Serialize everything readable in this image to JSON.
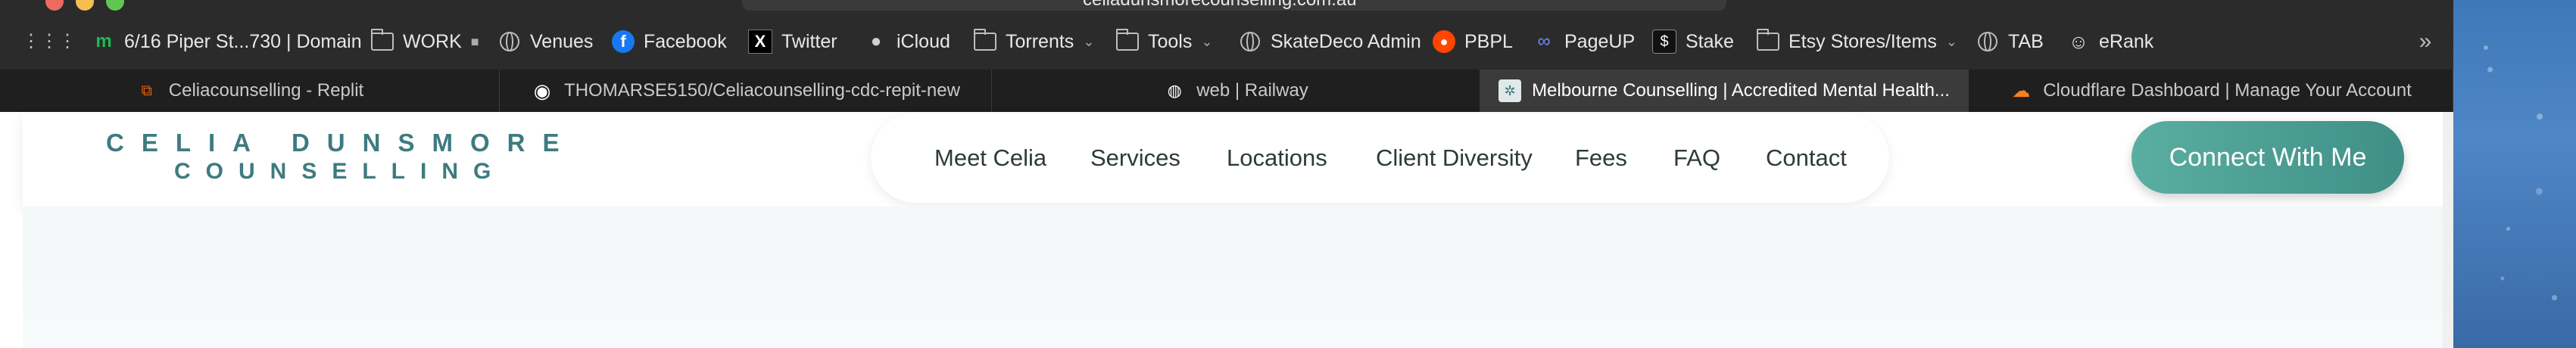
{
  "browser": {
    "url": "celiadunsmorecounselling.com.au"
  },
  "bookmarks": [
    {
      "label": "6/16 Piper St...730 | Domain",
      "icon": "domain-icon"
    },
    {
      "label": "WORK",
      "icon": "folder-icon"
    },
    {
      "label": "Venues",
      "icon": "globe-icon"
    },
    {
      "label": "Facebook",
      "icon": "facebook-icon"
    },
    {
      "label": "Twitter",
      "icon": "twitter-icon"
    },
    {
      "label": "iCloud",
      "icon": "apple-icon"
    },
    {
      "label": "Torrents",
      "icon": "folder-icon"
    },
    {
      "label": "Tools",
      "icon": "folder-icon"
    },
    {
      "label": "SkateDeco Admin",
      "icon": "globe-icon"
    },
    {
      "label": "PBPL",
      "icon": "reddit-icon"
    },
    {
      "label": "PageUP",
      "icon": "pageup-icon"
    },
    {
      "label": "Stake",
      "icon": "stake-icon"
    },
    {
      "label": "Etsy Stores/Items",
      "icon": "folder-icon"
    },
    {
      "label": "TAB",
      "icon": "globe-icon"
    },
    {
      "label": "eRank",
      "icon": "smiley-icon"
    }
  ],
  "tabs": [
    {
      "label": "Celiacounselling - Replit",
      "icon": "replit-icon",
      "active": false
    },
    {
      "label": "THOMARSE5150/Celiacounselling-cdc-repit-new",
      "icon": "github-icon",
      "active": false
    },
    {
      "label": "web | Railway",
      "icon": "railway-icon",
      "active": false
    },
    {
      "label": "Melbourne Counselling | Accredited Mental Health...",
      "icon": "site-favicon",
      "active": true
    },
    {
      "label": "Cloudflare Dashboard | Manage Your Account",
      "icon": "cloudflare-icon",
      "active": false
    }
  ],
  "site": {
    "logo_line1": "CELIA DUNSMORE",
    "logo_line2": "COUNSELLING",
    "nav": [
      "Meet Celia",
      "Services",
      "Locations",
      "Client Diversity",
      "Fees",
      "FAQ",
      "Contact"
    ],
    "cta": "Connect With Me"
  },
  "colors": {
    "brand": "#3e7b80",
    "cta": "#4a9e93",
    "chrome": "#2b2b2b"
  }
}
